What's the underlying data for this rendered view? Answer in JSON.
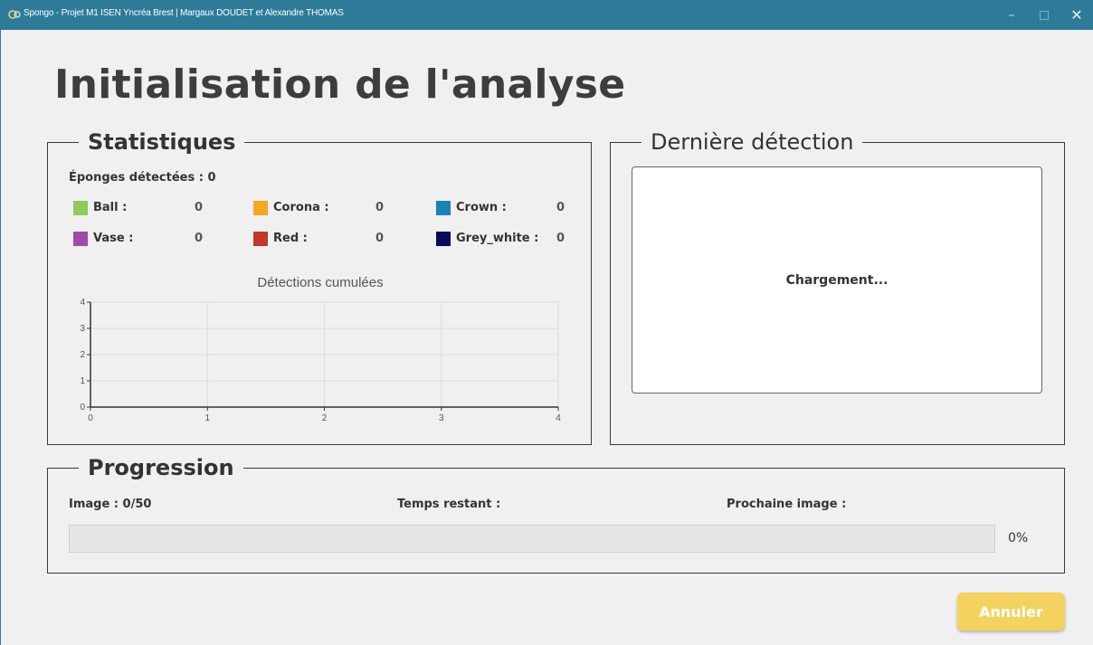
{
  "window": {
    "title": "Spongo - Projet M1 ISEN Yncréa Brest | Margaux DOUDET et Alexandre THOMAS",
    "minimize_glyph": "–",
    "close_glyph": "✕"
  },
  "page_title": "Initialisation de l'analyse",
  "stats": {
    "legend": "Statistiques",
    "detected": "Éponges détectées : 0",
    "classes": [
      {
        "name": "Ball :",
        "count": "0",
        "color": "#8fca5b"
      },
      {
        "name": "Corona :",
        "count": "0",
        "color": "#f5a623"
      },
      {
        "name": "Crown :",
        "count": "0",
        "color": "#1b82b5"
      },
      {
        "name": "Vase :",
        "count": "0",
        "color": "#a14aa8"
      },
      {
        "name": "Red :",
        "count": "0",
        "color": "#c0392b"
      },
      {
        "name": "Grey_white :",
        "count": "0",
        "color": "#0a0a5a"
      }
    ]
  },
  "chart_data": {
    "type": "line",
    "title": "Détections cumulées",
    "xlim": [
      0,
      4
    ],
    "ylim": [
      0,
      4
    ],
    "x_ticks": [
      "0",
      "1",
      "2",
      "3",
      "4"
    ],
    "y_ticks": [
      "0",
      "1",
      "2",
      "3",
      "4"
    ],
    "grid": true,
    "series": []
  },
  "last_detection": {
    "legend": "Dernière détection",
    "loading": "Chargement..."
  },
  "progress": {
    "legend": "Progression",
    "image_label": "Image : 0/50",
    "time_label": "Temps restant :",
    "next_label": "Prochaine image :",
    "percent_text": "0%",
    "value": 0
  },
  "buttons": {
    "cancel": "Annuler"
  }
}
